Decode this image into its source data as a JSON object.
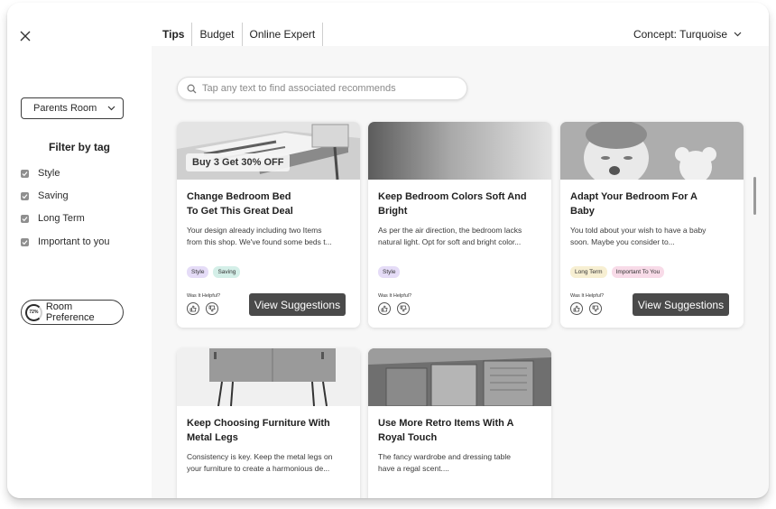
{
  "sidebar": {
    "room": "Parents Room",
    "filter_title": "Filter by tag",
    "tags": [
      "Style",
      "Saving",
      "Long Term",
      "Important to you"
    ],
    "preference": {
      "label": "Room Preference",
      "percent": "72%"
    }
  },
  "header": {
    "tabs": [
      "Tips",
      "Budget",
      "Online Expert"
    ],
    "concept": "Concept: Turquoise"
  },
  "search": {
    "placeholder": "Tap any text to find associated recommends"
  },
  "cards": [
    {
      "title_1": "Change Bedroom Bed",
      "title_2": "To Get This Great Deal",
      "desc_1": "Your design already including two Items",
      "desc_2": "from this shop. We've found some beds t...",
      "promo": "Buy 3 Get 30% OFF",
      "chips": [
        "Style",
        "Saving"
      ],
      "helpful": "Was It Helpful?",
      "button": "View Suggestions"
    },
    {
      "title_1": "Keep Bedroom Colors Soft And",
      "title_2": "Bright",
      "desc_1": "As per the air direction, the bedroom lacks",
      "desc_2": "natural light. Opt for soft and bright color...",
      "chips": [
        "Style"
      ],
      "helpful": "Was It Helpful?"
    },
    {
      "title_1": "Adapt Your Bedroom For A",
      "title_2": "Baby",
      "desc_1": "You told about your wish to have a baby",
      "desc_2": "soon. Maybe you consider to...",
      "chips": [
        "Long Term",
        "Important To You"
      ],
      "helpful": "Was It Helpful?",
      "button": "View Suggestions"
    },
    {
      "title_1": "Keep Choosing Furniture With",
      "title_2": "Metal Legs",
      "desc_1": "Consistency is key. Keep the metal legs on",
      "desc_2": "your furniture to create a harmonious de..."
    },
    {
      "title_1": "Use More Retro Items With A",
      "title_2": "Royal Touch",
      "desc_1": "The fancy wardrobe and dressing table",
      "desc_2": "have a regal scent...."
    }
  ],
  "colors": {
    "chip_style": "#e5dcf7",
    "chip_saving": "#d4efe8",
    "chip_long_term": "#f7efd2",
    "chip_important": "#f8dbe8",
    "button": "#4a4a4a"
  },
  "icons": [
    "close-icon",
    "chevron-down-icon",
    "search-icon",
    "checkmark-icon",
    "thumbs-up-icon",
    "thumbs-down-icon"
  ]
}
